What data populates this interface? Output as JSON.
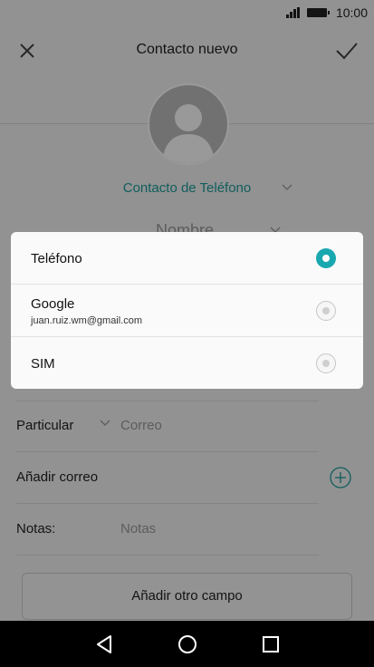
{
  "status": {
    "time": "10:00"
  },
  "header": {
    "title": "Contacto nuevo"
  },
  "form": {
    "account_label": "Contacto de Teléfono",
    "name_placeholder": "Nombre",
    "email_type": "Particular",
    "email_placeholder": "Correo",
    "add_email_label": "Añadir correo",
    "notes_label": "Notas:",
    "notes_placeholder": "Notas",
    "add_field_label": "Añadir otro campo"
  },
  "dialog": {
    "options": [
      {
        "label": "Teléfono",
        "sublabel": "",
        "selected": true
      },
      {
        "label": "Google",
        "sublabel": "juan.ruiz.wm@gmail.com",
        "selected": false
      },
      {
        "label": "SIM",
        "sublabel": "",
        "selected": false
      }
    ]
  },
  "colors": {
    "accent": "#19a8b0",
    "account_text": "#1c9c9c"
  },
  "icons": [
    "close-icon",
    "check-icon",
    "chevron-down-icon",
    "plus-circle-icon",
    "back-icon",
    "home-icon",
    "recents-icon",
    "signal-icon",
    "battery-icon"
  ]
}
